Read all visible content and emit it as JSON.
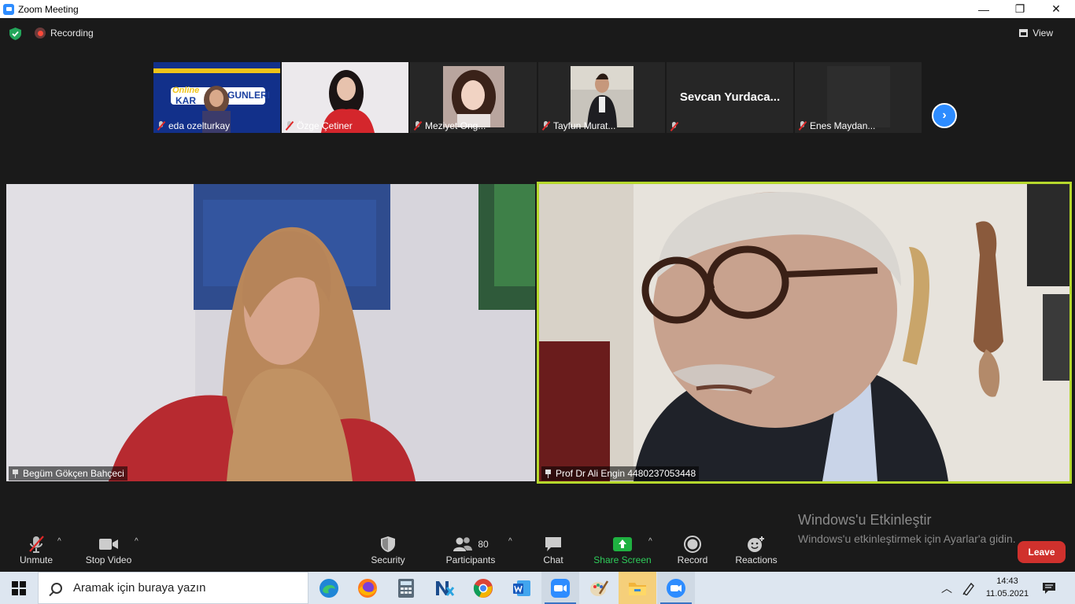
{
  "window": {
    "title": "Zoom Meeting",
    "minimize": "—",
    "restore": "❐",
    "close": "✕"
  },
  "topbar": {
    "recording_label": "Recording",
    "view_label": "View"
  },
  "thumbnails": [
    {
      "name": "eda ozelturkay",
      "muted": true,
      "banner_1": "Online",
      "banner_2": "KAR",
      "banner_3": "GUNLERI"
    },
    {
      "name": "Özge Çetiner",
      "muted": true
    },
    {
      "name": "Meziyet Ong...",
      "muted": true
    },
    {
      "name": "Tayfun Murat...",
      "muted": true
    },
    {
      "name": "",
      "display_name": "Sevcan  Yurdaca...",
      "muted": true
    },
    {
      "name": "Enes Maydan...",
      "muted": true
    }
  ],
  "videos": {
    "left": {
      "name": "Begüm Gökçen Bahçeci",
      "pinned": true
    },
    "right": {
      "name": "Prof Dr Ali Engin 4480237053448",
      "pinned": true,
      "active_speaker": true
    }
  },
  "watermark": {
    "line1": "Windows'u Etkinleştir",
    "line2": "Windows'u etkinleştirmek için Ayarlar'a gidin."
  },
  "toolbar": {
    "unmute": "Unmute",
    "stop_video": "Stop Video",
    "security": "Security",
    "participants": "Participants",
    "participants_count": "80",
    "chat": "Chat",
    "share_screen": "Share Screen",
    "record": "Record",
    "reactions": "Reactions",
    "leave": "Leave",
    "caret": "^"
  },
  "taskbar": {
    "search_placeholder": "Aramak için buraya yazın",
    "time": "14:43",
    "date": "11.05.2021",
    "apps": [
      "edge",
      "firefox",
      "calculator",
      "nx",
      "chrome",
      "word",
      "zoom",
      "paint",
      "file-explorer",
      "zoom-meeting"
    ]
  },
  "colors": {
    "accent": "#2d8cff",
    "active_speaker": "#b6d82c",
    "leave": "#d0312d",
    "share": "#1fb141"
  }
}
